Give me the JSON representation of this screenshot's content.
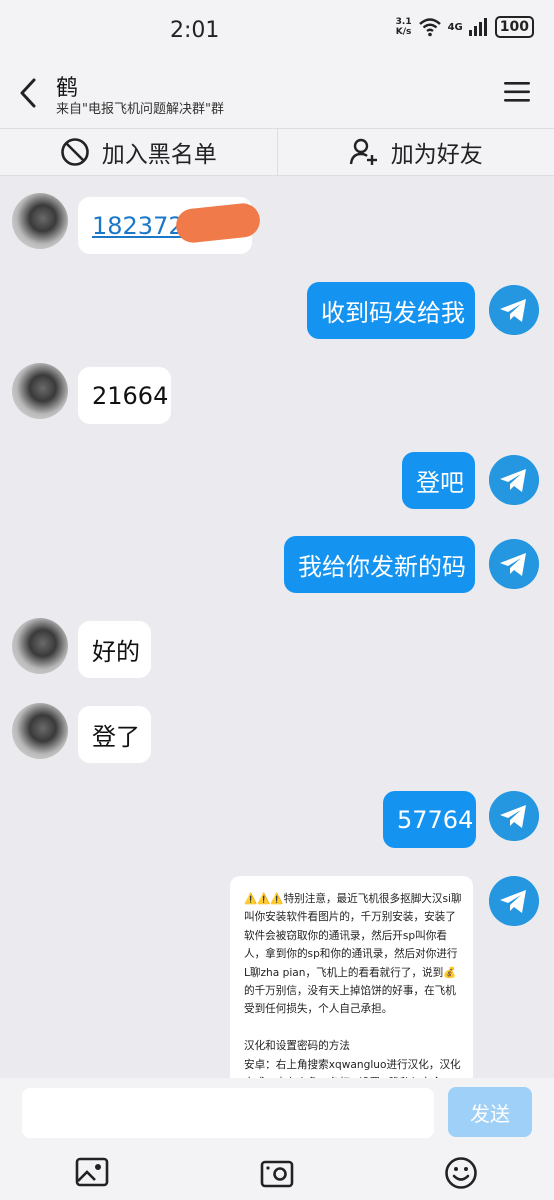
{
  "status": {
    "time": "2:01",
    "net_speed_value": "3.1",
    "net_speed_unit": "K/s",
    "network": "4G",
    "battery": "100"
  },
  "header": {
    "title": "鹤",
    "subtitle": "来自\"电报飞机问题解决群\"群"
  },
  "actions": {
    "blacklist_label": "加入黑名单",
    "add_friend_label": "加为好友"
  },
  "messages": [
    {
      "side": "in",
      "text": "1823722"
    },
    {
      "side": "out",
      "text": "收到码发给我"
    },
    {
      "side": "in",
      "text": "21664"
    },
    {
      "side": "out",
      "text": "登吧"
    },
    {
      "side": "out",
      "text": "我给你发新的码"
    },
    {
      "side": "in",
      "text": "好的"
    },
    {
      "side": "in",
      "text": "登了"
    },
    {
      "side": "out",
      "text": "57764"
    }
  ],
  "notice": {
    "text": "⚠️⚠️⚠️特别注意，最近飞机很多抠脚大汉si聊叫你安装软件看图片的，千万别安装，安装了软件会被窃取你的通讯录，然后开sp叫你看人，拿到你的sp和你的通讯录，然后对你进行L聊zha pian，飞机上的看看就行了，说到💰的千万别信，没有天上掉馅饼的好事，在飞机受到任何损失，个人自己承担。\n\n汉化和设置密码的方法\n安卓：右上角搜索xqwangluo进行汉化，汉化完成。点左上角三条杠→设置→隐私与安全→"
  },
  "input": {
    "placeholder": "",
    "send_label": "发送"
  },
  "colors": {
    "accent": "#1493f0",
    "send_disabled": "#9fd0f7",
    "background": "#ebebef"
  },
  "icons": [
    "back-icon",
    "menu-icon",
    "block-icon",
    "add-friend-icon",
    "telegram-icon",
    "image-icon",
    "camera-icon",
    "emoji-icon"
  ]
}
